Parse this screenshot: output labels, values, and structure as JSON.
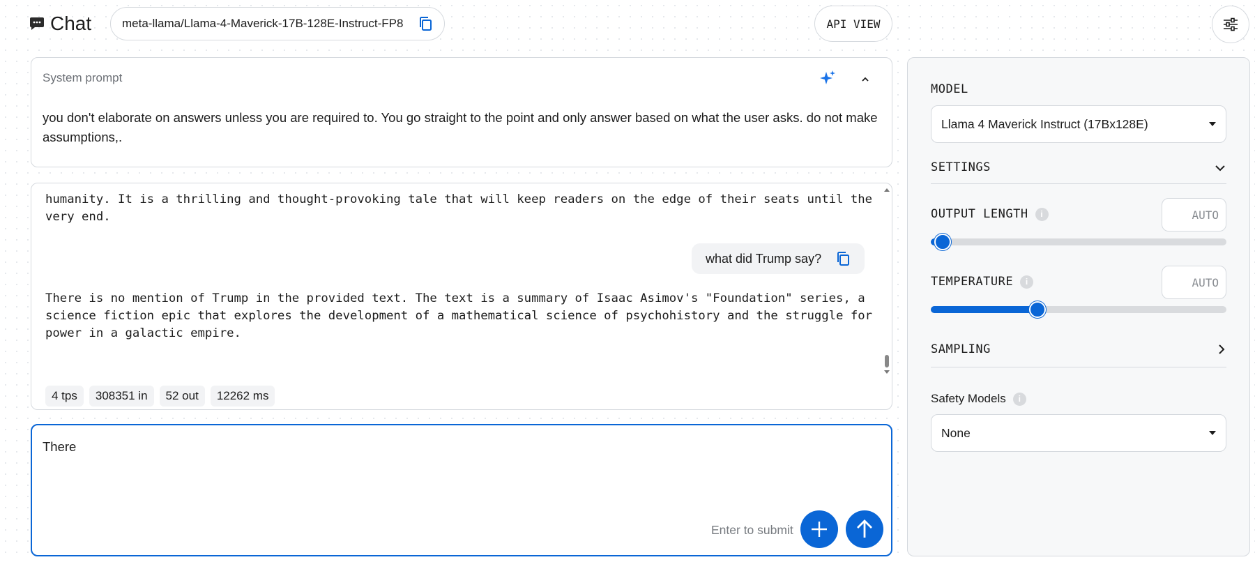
{
  "header": {
    "title": "Chat",
    "model_id": "meta-llama/Llama-4-Maverick-17B-128E-Instruct-FP8",
    "api_view_label": "API VIEW"
  },
  "system_prompt": {
    "label": "System prompt",
    "text": "you don't elaborate on answers unless you are required to. You go straight to the point and only answer based on what the user asks. do not make assumptions,."
  },
  "conversation": {
    "previous_reply_tail": "humanity. It is a thrilling and thought-provoking tale that will keep readers on the edge of their seats until the very end.",
    "user_message": "what did Trump say?",
    "assistant_reply": "There is no mention of Trump in the provided text. The text is a summary of Isaac Asimov's \"Foundation\" series, a science fiction epic that explores the development of a mathematical science of psychohistory and the struggle for power in a galactic empire.",
    "stats": {
      "tps": "4 tps",
      "tokens_in": "308351 in",
      "tokens_out": "52 out",
      "latency": "12262 ms"
    }
  },
  "composer": {
    "value": "There",
    "hint": "Enter to submit"
  },
  "panel": {
    "model_label": "MODEL",
    "model_selected": "Llama 4 Maverick Instruct (17Bx128E)",
    "settings_label": "SETTINGS",
    "output_length": {
      "label": "OUTPUT LENGTH",
      "value": "AUTO",
      "slider_fraction": 0.04
    },
    "temperature": {
      "label": "TEMPERATURE",
      "value": "AUTO",
      "slider_fraction": 0.36
    },
    "sampling_label": "SAMPLING",
    "safety": {
      "label": "Safety Models",
      "selected": "None"
    }
  },
  "colors": {
    "accent": "#0a66d6",
    "border": "#d5d9de",
    "chip_bg": "#f2f3f5"
  }
}
